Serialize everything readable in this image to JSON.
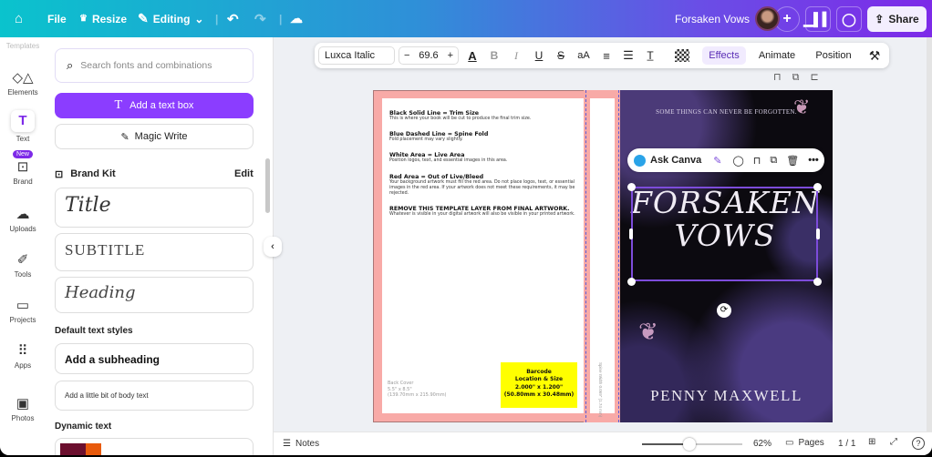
{
  "topbar": {
    "file": "File",
    "resize": "Resize",
    "editing": "Editing",
    "doc_title": "Forsaken Vows",
    "share": "Share",
    "icons": [
      "home-icon",
      "crown-icon",
      "pencil-icon",
      "chevron-down-icon",
      "undo-icon",
      "redo-icon",
      "cloud-check-icon",
      "plus-icon",
      "analytics-icon",
      "comment-icon",
      "share-icon"
    ]
  },
  "rail": {
    "templates": "Templates",
    "items": [
      {
        "label": "Elements",
        "icon": "elements-icon"
      },
      {
        "label": "Text",
        "icon": "text-icon"
      },
      {
        "label": "Brand",
        "icon": "brand-icon",
        "badge": "New"
      },
      {
        "label": "Uploads",
        "icon": "upload-icon"
      },
      {
        "label": "Tools",
        "icon": "tools-icon"
      },
      {
        "label": "Projects",
        "icon": "folder-icon"
      },
      {
        "label": "Apps",
        "icon": "apps-icon"
      },
      {
        "label": "Photos",
        "icon": "photos-icon"
      }
    ]
  },
  "panel": {
    "search_placeholder": "Search fonts and combinations",
    "add_text_box": "Add a text box",
    "magic_write": "Magic Write",
    "brand_kit": "Brand Kit",
    "edit": "Edit",
    "brand_styles": [
      "Title",
      "SUBTITLE",
      "Heading"
    ],
    "default_styles_heading": "Default text styles",
    "subheading": "Add a subheading",
    "body": "Add a little bit of body text",
    "dynamic_text": "Dynamic text"
  },
  "toolbar": {
    "font": "Luxca Italic",
    "size": "69.6",
    "minus": "−",
    "plus": "+",
    "effects": "Effects",
    "animate": "Animate",
    "position": "Position",
    "accent": "#7d2ae8"
  },
  "ask": {
    "label": "Ask Canva"
  },
  "back": {
    "sections": [
      {
        "title": "Black Solid Line = Trim Size",
        "body": "This is where your book will be cut to produce the final trim size."
      },
      {
        "title": "Blue Dashed Line = Spine Fold",
        "body": "Fold placement may vary slightly."
      },
      {
        "title": "White Area = Live Area",
        "body": "Position logos, text, and essential images in this area."
      },
      {
        "title": "Red Area = Out of Live/Bleed",
        "body": "Your background artwork must fill the red area. Do not place logos, text, or essential images in the red area. If your artwork does not meet these requirements, it may be rejected."
      },
      {
        "title": "REMOVE THIS TEMPLATE LAYER FROM FINAL ARTWORK.",
        "body": "Whatever is visible in your digital artwork will also be visible in your printed artwork."
      }
    ],
    "cover_label": "Back Cover",
    "cover_size": "5.5\" x 8.5\"",
    "cover_mm": "(139.70mm x 215.90mm)",
    "barcode": [
      "Barcode",
      "Location & Size",
      "2.000\" x 1.200\"",
      "(50.80mm x 30.48mm)"
    ],
    "spine_text": "Spine Width 0.069\" (1.74 mm)"
  },
  "front": {
    "tagline": "SOME THINGS CAN NEVER BE FORGOTTEN.",
    "title_1": "FORSAKEN",
    "title_2": "VOWS",
    "author": "PENNY MAXWELL"
  },
  "bottom": {
    "notes": "Notes",
    "zoom": "62%",
    "zoom_value": 62,
    "pages": "Pages",
    "page_count": "1 / 1",
    "help": "?"
  }
}
